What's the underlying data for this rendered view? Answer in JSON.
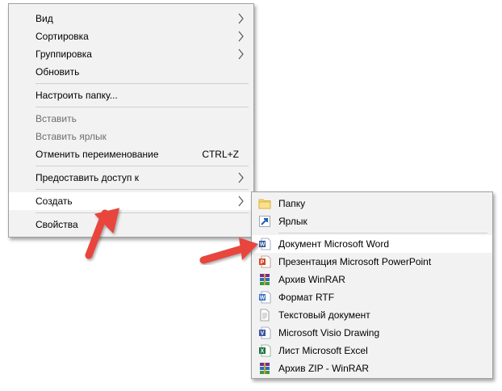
{
  "context_menu": {
    "items": [
      {
        "label": "Вид"
      },
      {
        "label": "Сортировка"
      },
      {
        "label": "Группировка"
      },
      {
        "label": "Обновить"
      },
      {
        "label": "Настроить папку..."
      },
      {
        "label": "Вставить"
      },
      {
        "label": "Вставить ярлык"
      },
      {
        "label": "Отменить переименование",
        "shortcut": "CTRL+Z"
      },
      {
        "label": "Предоставить доступ к"
      },
      {
        "label": "Создать"
      },
      {
        "label": "Свойства"
      }
    ]
  },
  "create_submenu": {
    "items": [
      {
        "label": "Папку",
        "icon": "folder-icon"
      },
      {
        "label": "Ярлык",
        "icon": "shortcut-icon"
      },
      {
        "label": "Документ Microsoft Word",
        "icon": "word-icon"
      },
      {
        "label": "Презентация Microsoft PowerPoint",
        "icon": "powerpoint-icon"
      },
      {
        "label": "Архив WinRAR",
        "icon": "winrar-icon"
      },
      {
        "label": "Формат RTF",
        "icon": "rtf-icon"
      },
      {
        "label": "Текстовый документ",
        "icon": "text-document-icon"
      },
      {
        "label": "Microsoft Visio Drawing",
        "icon": "visio-icon"
      },
      {
        "label": "Лист Microsoft Excel",
        "icon": "excel-icon"
      },
      {
        "label": "Архив ZIP - WinRAR",
        "icon": "winrar-zip-icon"
      }
    ]
  },
  "colors": {
    "menu_bg": "#f2f2f2",
    "highlight_bg": "#ffffff",
    "disabled_text": "#6d6d6d",
    "annotation_arrow": "#e8453c"
  }
}
